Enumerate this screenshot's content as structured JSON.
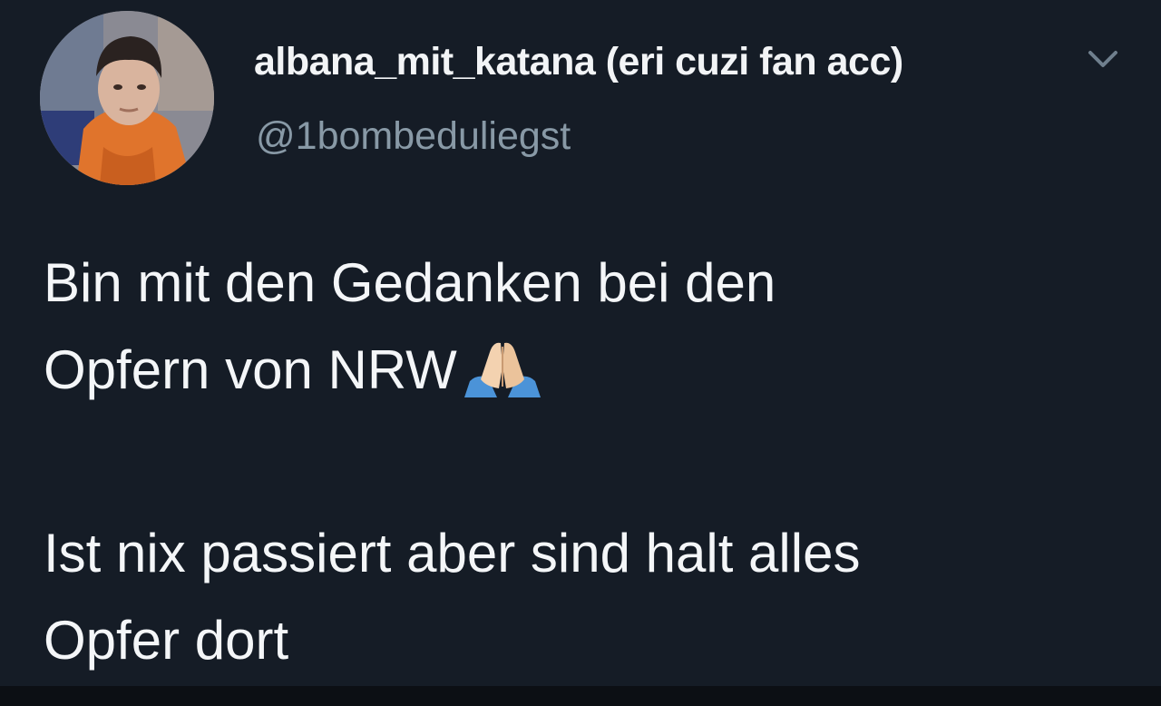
{
  "tweet": {
    "display_name": "albana_mit_katana (eri cuzi fan acc)",
    "handle": "@1bombeduliegst",
    "text_line_1": "Bin mit den Gedanken bei den",
    "text_line_2": "Opfern von NRW",
    "text_line_3": "Ist nix passiert aber sind halt alles",
    "text_line_4": "Opfer dort",
    "emoji": "folded-hands"
  },
  "icons": {
    "menu": "chevron-down-icon",
    "reaction": "folded-hands-emoji-icon"
  },
  "colors": {
    "background": "#151c26",
    "name_text": "#f2f4f6",
    "handle_text": "#8899a6",
    "body_text": "#f4f6f8"
  }
}
